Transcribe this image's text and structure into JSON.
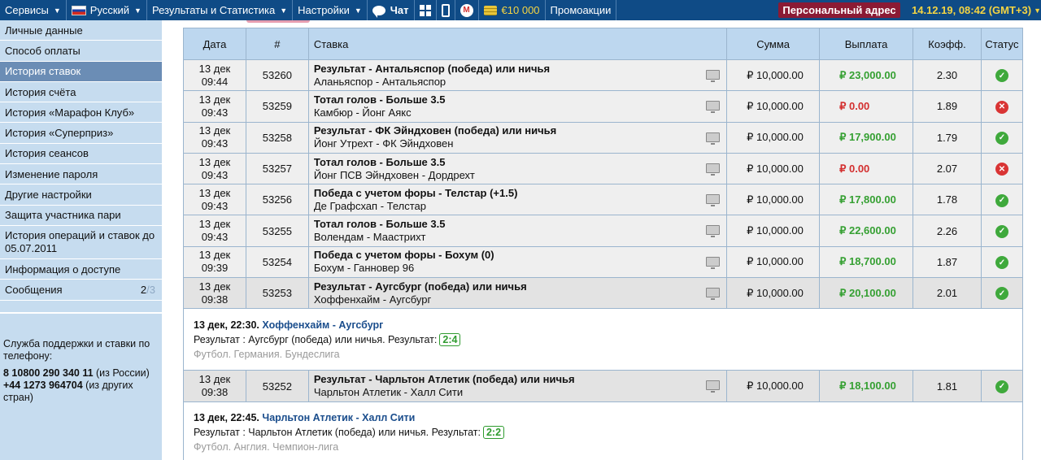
{
  "topbar": {
    "services": "Сервисы",
    "language": "Русский",
    "results": "Результаты и Статистика",
    "settings": "Настройки",
    "chat": "Чат",
    "bonus": "€10 000",
    "promos": "Промоакции",
    "personal_address": "Персональный адрес",
    "clock": "14.12.19, 08:42 (GMT+3)"
  },
  "sidebar": {
    "items": [
      {
        "label": "Личные данные"
      },
      {
        "label": "Способ оплаты"
      },
      {
        "label": "История ставок"
      },
      {
        "label": "История счёта"
      },
      {
        "label": "История «Марафон Клуб»"
      },
      {
        "label": "История «Суперприз»"
      },
      {
        "label": "История сеансов"
      },
      {
        "label": "Изменение пароля"
      },
      {
        "label": "Другие настройки"
      },
      {
        "label": "Защита участника пари"
      },
      {
        "label": "История операций и ставок до 05.07.2011"
      },
      {
        "label": "Информация о доступе"
      },
      {
        "label": "Сообщения",
        "count_new": "2",
        "count_total": "/3"
      }
    ],
    "support": {
      "title": "Служба поддержки и ставки по телефону:",
      "phone_ru": "8 10800 290 340 11",
      "phone_ru_note": "(из России)",
      "phone_intl": "+44 1273 964704",
      "phone_intl_note": "(из других стран)"
    }
  },
  "table": {
    "headers": {
      "date": "Дата",
      "number": "#",
      "bet": "Ставка",
      "sum": "Сумма",
      "payout": "Выплата",
      "coef": "Коэфф.",
      "status": "Статус"
    },
    "rows": [
      {
        "day": "13 дек",
        "time": "09:44",
        "id": "53260",
        "title": "Результат - Антальяспор (победа) или ничья",
        "match": "Аланьяспор - Антальяспор",
        "sum": "₽ 10,000.00",
        "payout": "₽ 23,000.00",
        "coef": "2.30",
        "status": "win"
      },
      {
        "day": "13 дек",
        "time": "09:43",
        "id": "53259",
        "title": "Тотал голов - Больше 3.5",
        "match": "Камбюр - Йонг Аякс",
        "sum": "₽ 10,000.00",
        "payout": "₽ 0.00",
        "coef": "1.89",
        "status": "lose"
      },
      {
        "day": "13 дек",
        "time": "09:43",
        "id": "53258",
        "title": "Результат - ФК Эйндховен (победа) или ничья",
        "match": "Йонг Утрехт - ФК Эйндховен",
        "sum": "₽ 10,000.00",
        "payout": "₽ 17,900.00",
        "coef": "1.79",
        "status": "win"
      },
      {
        "day": "13 дек",
        "time": "09:43",
        "id": "53257",
        "title": "Тотал голов - Больше 3.5",
        "match": "Йонг ПСВ Эйндховен - Дордрехт",
        "sum": "₽ 10,000.00",
        "payout": "₽ 0.00",
        "coef": "2.07",
        "status": "lose"
      },
      {
        "day": "13 дек",
        "time": "09:43",
        "id": "53256",
        "title": "Победа с учетом форы - Телстар (+1.5)",
        "match": "Де Графсхап - Телстар",
        "sum": "₽ 10,000.00",
        "payout": "₽ 17,800.00",
        "coef": "1.78",
        "status": "win"
      },
      {
        "day": "13 дек",
        "time": "09:43",
        "id": "53255",
        "title": "Тотал голов - Больше 3.5",
        "match": "Волендам - Маастрихт",
        "sum": "₽ 10,000.00",
        "payout": "₽ 22,600.00",
        "coef": "2.26",
        "status": "win"
      },
      {
        "day": "13 дек",
        "time": "09:39",
        "id": "53254",
        "title": "Победа с учетом форы - Бохум (0)",
        "match": "Бохум - Ганновер 96",
        "sum": "₽ 10,000.00",
        "payout": "₽ 18,700.00",
        "coef": "1.87",
        "status": "win"
      },
      {
        "day": "13 дек",
        "time": "09:38",
        "id": "53253",
        "title": "Результат - Аугсбург (победа) или ничья",
        "match": "Хоффенхайм - Аугсбург",
        "sum": "₽ 10,000.00",
        "payout": "₽ 20,100.00",
        "coef": "2.01",
        "status": "win"
      }
    ],
    "detail1": {
      "when": "13 дек, 22:30.",
      "match": "Хоффенхайм - Аугсбург",
      "result_text": "Результат : Аугсбург (победа) или ничья. Результат:",
      "score": "2:4",
      "league": "Футбол. Германия. Бундеслига"
    },
    "row9": {
      "day": "13 дек",
      "time": "09:38",
      "id": "53252",
      "title": "Результат - Чарльтон Атлетик (победа) или ничья",
      "match": "Чарльтон Атлетик - Халл Сити",
      "sum": "₽ 10,000.00",
      "payout": "₽ 18,100.00",
      "coef": "1.81",
      "status": "win"
    },
    "detail2": {
      "when": "13 дек, 22:45.",
      "match": "Чарльтон Атлетик - Халл Сити",
      "result_text": "Результат : Чарльтон Атлетик (победа) или ничья. Результат:",
      "score": "2:2",
      "league": "Футбол. Англия. Чемпион-лига"
    }
  }
}
